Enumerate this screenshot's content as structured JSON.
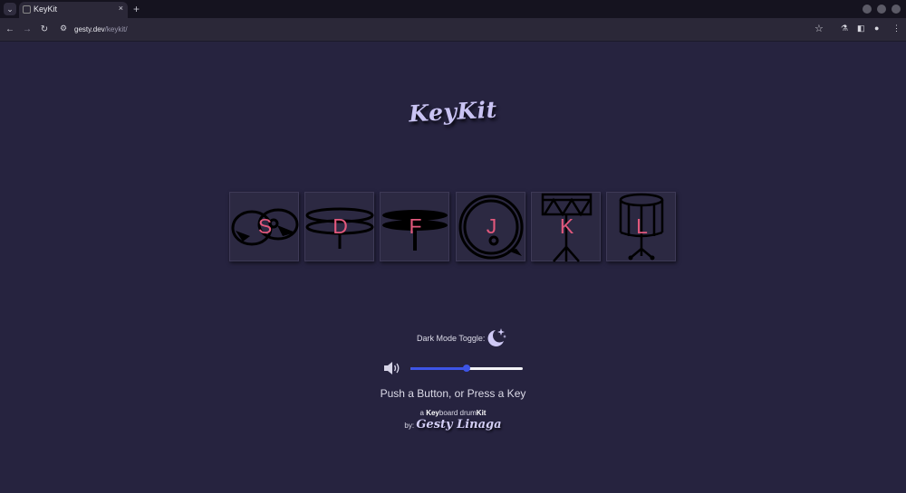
{
  "browser": {
    "tab_title": "KeyKit",
    "tab_close": "×",
    "new_tab": "+",
    "url_host": "gesty.dev",
    "url_path": "/keykit/"
  },
  "app": {
    "logo": "KeyKit",
    "pads": [
      {
        "key": "S",
        "drum": "crash-cymbals"
      },
      {
        "key": "D",
        "drum": "hi-hat"
      },
      {
        "key": "F",
        "drum": "ride-cymbal"
      },
      {
        "key": "J",
        "drum": "bass-drum"
      },
      {
        "key": "K",
        "drum": "tom-drum"
      },
      {
        "key": "L",
        "drum": "snare-drum"
      }
    ],
    "dark_mode_label": "Dark Mode Toggle:",
    "volume_fraction": 0.5,
    "prompt": "Push a Button, or Press a Key",
    "tagline": {
      "a": "a ",
      "key": "Key",
      "board": "board drum",
      "kit": "Kit"
    },
    "by_label": "by:",
    "author": "Gesty Linaga"
  },
  "colors": {
    "background": "#26233f",
    "key_letter": "#e1587c",
    "slider_accent": "#3d54e6",
    "logo": "#c9c3f3"
  }
}
